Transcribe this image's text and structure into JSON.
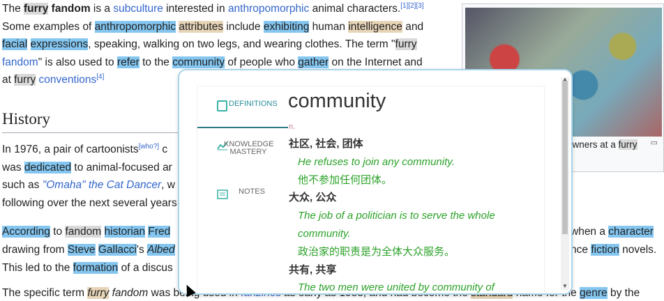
{
  "article": {
    "l1": {
      "a": "The ",
      "furry": "furry",
      "fandom": "fandom",
      "b": " is a ",
      "subculture": "subculture",
      "c": " interested in ",
      "anthro": "anthropomorphic",
      "d": " animal characters.",
      "refs": "[1][2][3]"
    },
    "l2": {
      "a": "Some examples of ",
      "anthro": "anthropomorphic",
      "b": " ",
      "attributes": "attributes",
      "c": " include ",
      "exhibiting": "exhibiting",
      "d": " human ",
      "intelligence": "intelligence",
      "e": " and"
    },
    "l3": {
      "facial": "facial",
      "a": " ",
      "expressions": "expressions",
      "b": ", speaking, walking on two legs, and wearing clothes. The term \"",
      "furry": "furry"
    },
    "l4": {
      "fandom": "fandom",
      "a": "\" is also used to ",
      "refer": "refer",
      "b": " to the ",
      "community": "community",
      "c": " of people who ",
      "gather": "gather",
      "d": " on the Internet and"
    },
    "l5": {
      "a": "at ",
      "furry": "furry",
      "b": " ",
      "conventions": "conventions",
      ".": ".",
      "ref": "[4]"
    },
    "history": "History",
    "l6": {
      "a": "In 1976, a pair of cartoonists",
      "ref": "[who?]",
      "b": " c"
    },
    "l7": {
      "a": "was ",
      "dedicated": "dedicated",
      "b": " to animal-focused ar"
    },
    "l8": {
      "a": "such as ",
      "omaha": "\"Omaha\" the Cat Dancer",
      ",": ", w"
    },
    "l9": {
      "a": "following over the next several years"
    },
    "l10": {
      "according": "According",
      "a": " to ",
      "fandom": "fandom",
      "b": " ",
      "historian": "historian",
      "c": " ",
      "fred": "Fred",
      "right_a": " when a ",
      "character": "character"
    },
    "l11": {
      "a": "drawing from ",
      "steve": "Steve",
      "b": " ",
      "gallacci": "Gallacci",
      "c": "'s ",
      "albed": "Albed",
      "right_a": "nce ",
      "fiction": "fiction",
      "right_b": " novels."
    },
    "l12": {
      "a": "This led to the ",
      "formation": "formation",
      "b": " of a discus"
    },
    "l13": {
      "a": "The specific term ",
      "furry": "furry",
      "b": " ",
      "fandom": "fandom",
      "c": " was being used in ",
      "fanzines": "fanzines",
      "d": " as early as 1983, and had become the ",
      "standard": "standard",
      "e": " name for the ",
      "genre": "genre",
      "f": " by the"
    }
  },
  "infobox": {
    "caption_a": "owners at a ",
    "caption_furry": "furry",
    "enlarge": "▭"
  },
  "popup": {
    "tabs": {
      "definitions": "DEFINITIONS",
      "knowledge": "KNOWLEDGE MASTERY",
      "notes": "NOTES"
    },
    "word": "community",
    "pos": "n.",
    "senses": [
      {
        "zh": "社区, 社会, 团体",
        "ex_en": "He refuses to join any community.",
        "ex_zh": "他不参加任何团体。"
      },
      {
        "zh": "大众, 公众",
        "ex_en": "The job of a politician is to serve the whole community.",
        "ex_zh": "政治家的职责是为全体大众服务。"
      },
      {
        "zh": "共有, 共享",
        "ex_en": "The two men were united by community of",
        "ex_zh": ""
      }
    ]
  }
}
